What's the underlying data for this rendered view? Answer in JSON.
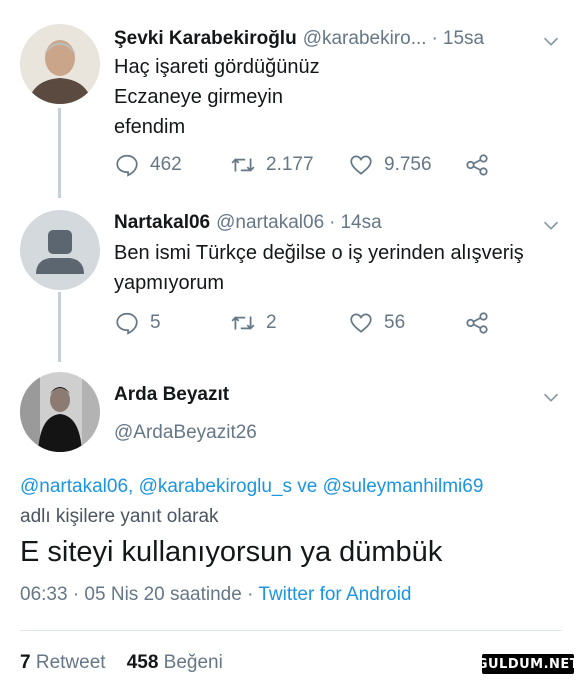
{
  "tweets": [
    {
      "name": "Şevki Karabekiroğlu",
      "handle": "@karabekiro...",
      "time": "15sa",
      "body": [
        "Haç işareti gördüğünüz",
        "Eczaneye girmeyin",
        "efendim"
      ],
      "replies": "462",
      "retweets": "2.177",
      "likes": "9.756"
    },
    {
      "name": "Nartakal06",
      "handle": "@nartakal06",
      "time": "14sa",
      "body": [
        "Ben ismi Türkçe değilse o iş yerinden alışveriş",
        "yapmıyorum"
      ],
      "replies": "5",
      "retweets": "2",
      "likes": "56"
    }
  ],
  "main_tweet": {
    "name": "Arda Beyazıt",
    "handle": "@ArdaBeyazit26",
    "reply_mentions": "@nartakal06, @karabekiroglu_s ve @suleymanhilmi69",
    "reply_suffix": "adlı kişilere yanıt olarak",
    "text": "E siteyi kullanıyorsun ya dümbük",
    "timestamp": "06:33 · 05 Nis 20 saatinde · ",
    "source": "Twitter for Android",
    "retweet_count": "7",
    "retweet_label": "Retweet",
    "like_count": "458",
    "like_label": "Beğeni"
  },
  "watermark": "GULDUM.NET",
  "colors": {
    "accent": "#1b95e0",
    "muted": "#657786",
    "line": "#c5cfd6"
  },
  "icons": [
    "reply-icon",
    "retweet-icon",
    "like-icon",
    "share-icon",
    "chevron-down-icon"
  ]
}
